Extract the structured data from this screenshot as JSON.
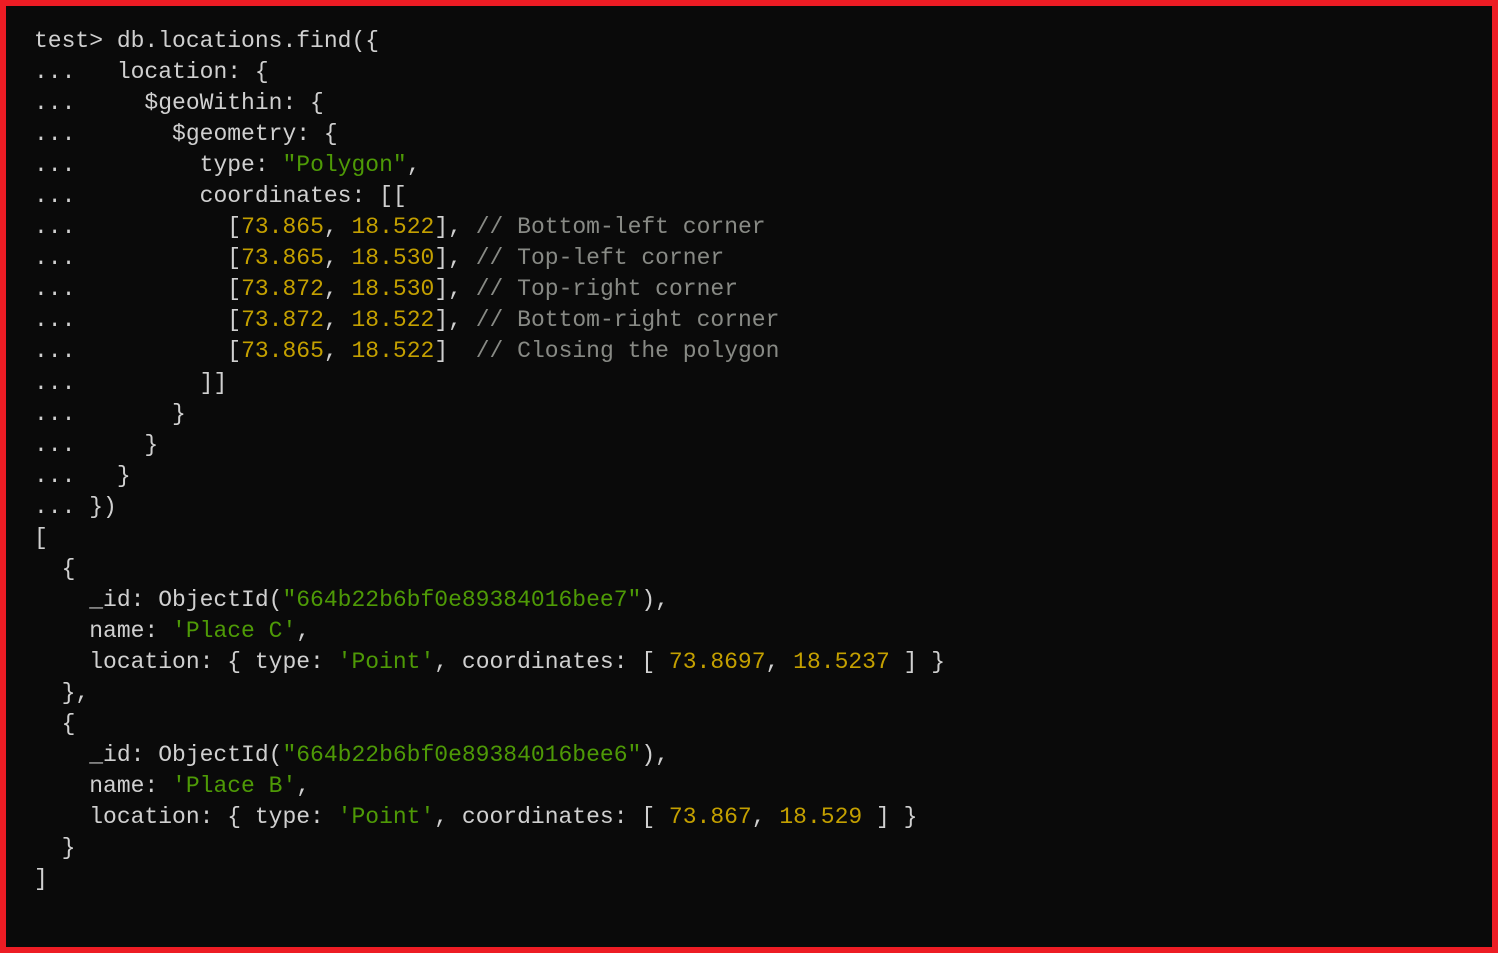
{
  "prompt": "test>",
  "continuation": "...",
  "query": {
    "start": "db.locations.find({",
    "line2": "   location: {",
    "line3": "     $geoWithin: {",
    "line4": "       $geometry: {",
    "line5": "         type: ",
    "polygon_label": "\"Polygon\"",
    "line5_end": ",",
    "line6": "         coordinates: [[",
    "coord_indent": "           [",
    "coord_sep": ", ",
    "coord_close_comma": "], ",
    "coord_close_last": "]  ",
    "coords": {
      "c1a": "73.865",
      "c1b": "18.522",
      "cmt1": "// Bottom-left corner",
      "c2a": "73.865",
      "c2b": "18.530",
      "cmt2": "// Top-left corner",
      "c3a": "73.872",
      "c3b": "18.530",
      "cmt3": "// Top-right corner",
      "c4a": "73.872",
      "c4b": "18.522",
      "cmt4": "// Bottom-right corner",
      "c5a": "73.865",
      "c5b": "18.522",
      "cmt5": "// Closing the polygon"
    },
    "line12": "         ]]",
    "line13": "       }",
    "line14": "     }",
    "line15": "   }",
    "line16": " })"
  },
  "output": {
    "open": "[",
    "r1": {
      "open": "  {",
      "id_label": "    _id: ObjectId(",
      "id": "\"664b22b6bf0e89384016bee7\"",
      "id_close": "),",
      "name_label": "    name: ",
      "name": "'Place C'",
      "name_close": ",",
      "loc_label": "    location: { type: ",
      "loc_type": "'Point'",
      "loc_mid": ", coordinates: [ ",
      "lng": "73.8697",
      "sep": ", ",
      "lat": "18.5237",
      "loc_close": " ] }",
      "close": "  },"
    },
    "r2": {
      "open": "  {",
      "id_label": "    _id: ObjectId(",
      "id": "\"664b22b6bf0e89384016bee6\"",
      "id_close": "),",
      "name_label": "    name: ",
      "name": "'Place B'",
      "name_close": ",",
      "loc_label": "    location: { type: ",
      "loc_type": "'Point'",
      "loc_mid": ", coordinates: [ ",
      "lng": "73.867",
      "sep": ", ",
      "lat": "18.529",
      "loc_close": " ] }",
      "close": "  }"
    },
    "close": "]"
  }
}
